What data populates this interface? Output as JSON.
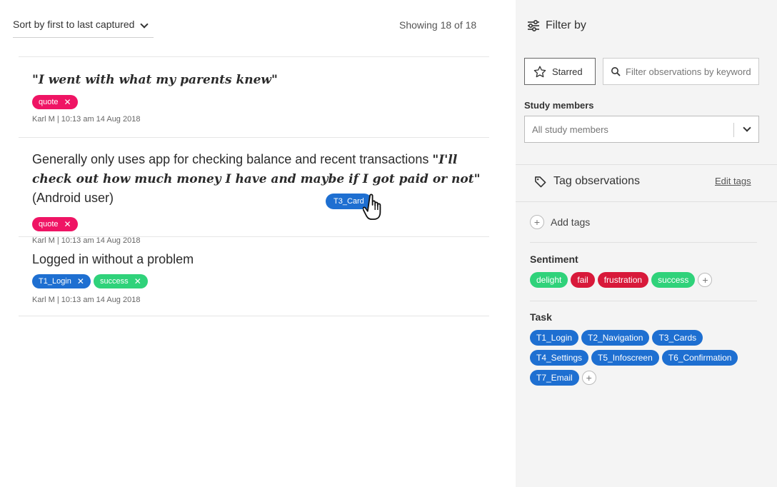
{
  "colors": {
    "quote": "#ef1464",
    "task": "#1e6fd1",
    "success": "#2fd27a",
    "fail": "#d8193a",
    "frustration": "#d8193a",
    "delight": "#2fd27a"
  },
  "toolbar": {
    "sort_label": "Sort by first to last captured",
    "showing": "Showing 18 of 18"
  },
  "observations": [
    {
      "quote": "\"I went with what my parents knew\"",
      "tags": [
        {
          "label": "quote",
          "color": "pink"
        }
      ],
      "meta": "Karl M | 10:13 am 14 Aug 2018"
    },
    {
      "text_before": "Generally only uses app for checking balance and recent transactions ",
      "quote": "\"I'll check out how much money I have and maybe if I got paid or not\"",
      "text_after": " (Android user)",
      "tags": [
        {
          "label": "quote",
          "color": "pink"
        }
      ],
      "meta": "Karl M | 10:13 am 14 Aug 2018"
    },
    {
      "text": "Logged in without a problem",
      "tags": [
        {
          "label": "T1_Login",
          "color": "blue"
        },
        {
          "label": "success",
          "color": "green"
        }
      ],
      "meta": "Karl M | 10:13 am 14 Aug 2018"
    }
  ],
  "drag_chip": "T3_Card",
  "sidebar": {
    "filter_title": "Filter by",
    "starred_label": "Starred",
    "keyword_placeholder": "Filter observations by keyword",
    "members_label": "Study members",
    "members_value": "All study members",
    "tag_title": "Tag observations",
    "edit_tags": "Edit tags",
    "add_tags": "Add tags",
    "sentiment_label": "Sentiment",
    "sentiment_tags": [
      {
        "label": "delight",
        "color": "green"
      },
      {
        "label": "fail",
        "color": "red"
      },
      {
        "label": "frustration",
        "color": "red"
      },
      {
        "label": "success",
        "color": "green"
      }
    ],
    "task_label": "Task",
    "task_tags": [
      "T1_Login",
      "T2_Navigation",
      "T3_Cards",
      "T4_Settings",
      "T5_Infoscreen",
      "T6_Confirmation",
      "T7_Email"
    ]
  }
}
